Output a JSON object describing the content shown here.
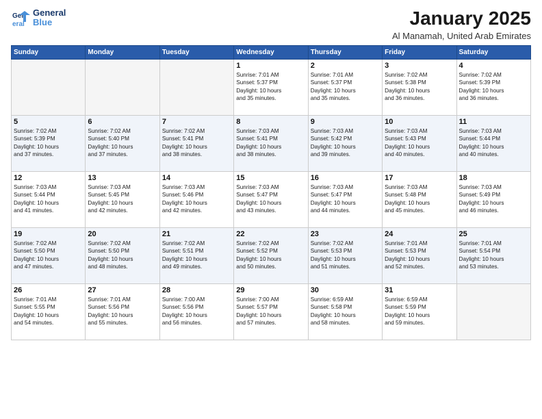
{
  "logo": {
    "line1": "General",
    "line2": "Blue"
  },
  "title": "January 2025",
  "subtitle": "Al Manamah, United Arab Emirates",
  "days_header": [
    "Sunday",
    "Monday",
    "Tuesday",
    "Wednesday",
    "Thursday",
    "Friday",
    "Saturday"
  ],
  "weeks": [
    {
      "shade": false,
      "days": [
        {
          "num": "",
          "info": ""
        },
        {
          "num": "",
          "info": ""
        },
        {
          "num": "",
          "info": ""
        },
        {
          "num": "1",
          "info": "Sunrise: 7:01 AM\nSunset: 5:37 PM\nDaylight: 10 hours\nand 35 minutes."
        },
        {
          "num": "2",
          "info": "Sunrise: 7:01 AM\nSunset: 5:37 PM\nDaylight: 10 hours\nand 35 minutes."
        },
        {
          "num": "3",
          "info": "Sunrise: 7:02 AM\nSunset: 5:38 PM\nDaylight: 10 hours\nand 36 minutes."
        },
        {
          "num": "4",
          "info": "Sunrise: 7:02 AM\nSunset: 5:39 PM\nDaylight: 10 hours\nand 36 minutes."
        }
      ]
    },
    {
      "shade": true,
      "days": [
        {
          "num": "5",
          "info": "Sunrise: 7:02 AM\nSunset: 5:39 PM\nDaylight: 10 hours\nand 37 minutes."
        },
        {
          "num": "6",
          "info": "Sunrise: 7:02 AM\nSunset: 5:40 PM\nDaylight: 10 hours\nand 37 minutes."
        },
        {
          "num": "7",
          "info": "Sunrise: 7:02 AM\nSunset: 5:41 PM\nDaylight: 10 hours\nand 38 minutes."
        },
        {
          "num": "8",
          "info": "Sunrise: 7:03 AM\nSunset: 5:41 PM\nDaylight: 10 hours\nand 38 minutes."
        },
        {
          "num": "9",
          "info": "Sunrise: 7:03 AM\nSunset: 5:42 PM\nDaylight: 10 hours\nand 39 minutes."
        },
        {
          "num": "10",
          "info": "Sunrise: 7:03 AM\nSunset: 5:43 PM\nDaylight: 10 hours\nand 40 minutes."
        },
        {
          "num": "11",
          "info": "Sunrise: 7:03 AM\nSunset: 5:44 PM\nDaylight: 10 hours\nand 40 minutes."
        }
      ]
    },
    {
      "shade": false,
      "days": [
        {
          "num": "12",
          "info": "Sunrise: 7:03 AM\nSunset: 5:44 PM\nDaylight: 10 hours\nand 41 minutes."
        },
        {
          "num": "13",
          "info": "Sunrise: 7:03 AM\nSunset: 5:45 PM\nDaylight: 10 hours\nand 42 minutes."
        },
        {
          "num": "14",
          "info": "Sunrise: 7:03 AM\nSunset: 5:46 PM\nDaylight: 10 hours\nand 42 minutes."
        },
        {
          "num": "15",
          "info": "Sunrise: 7:03 AM\nSunset: 5:47 PM\nDaylight: 10 hours\nand 43 minutes."
        },
        {
          "num": "16",
          "info": "Sunrise: 7:03 AM\nSunset: 5:47 PM\nDaylight: 10 hours\nand 44 minutes."
        },
        {
          "num": "17",
          "info": "Sunrise: 7:03 AM\nSunset: 5:48 PM\nDaylight: 10 hours\nand 45 minutes."
        },
        {
          "num": "18",
          "info": "Sunrise: 7:03 AM\nSunset: 5:49 PM\nDaylight: 10 hours\nand 46 minutes."
        }
      ]
    },
    {
      "shade": true,
      "days": [
        {
          "num": "19",
          "info": "Sunrise: 7:02 AM\nSunset: 5:50 PM\nDaylight: 10 hours\nand 47 minutes."
        },
        {
          "num": "20",
          "info": "Sunrise: 7:02 AM\nSunset: 5:50 PM\nDaylight: 10 hours\nand 48 minutes."
        },
        {
          "num": "21",
          "info": "Sunrise: 7:02 AM\nSunset: 5:51 PM\nDaylight: 10 hours\nand 49 minutes."
        },
        {
          "num": "22",
          "info": "Sunrise: 7:02 AM\nSunset: 5:52 PM\nDaylight: 10 hours\nand 50 minutes."
        },
        {
          "num": "23",
          "info": "Sunrise: 7:02 AM\nSunset: 5:53 PM\nDaylight: 10 hours\nand 51 minutes."
        },
        {
          "num": "24",
          "info": "Sunrise: 7:01 AM\nSunset: 5:53 PM\nDaylight: 10 hours\nand 52 minutes."
        },
        {
          "num": "25",
          "info": "Sunrise: 7:01 AM\nSunset: 5:54 PM\nDaylight: 10 hours\nand 53 minutes."
        }
      ]
    },
    {
      "shade": false,
      "days": [
        {
          "num": "26",
          "info": "Sunrise: 7:01 AM\nSunset: 5:55 PM\nDaylight: 10 hours\nand 54 minutes."
        },
        {
          "num": "27",
          "info": "Sunrise: 7:01 AM\nSunset: 5:56 PM\nDaylight: 10 hours\nand 55 minutes."
        },
        {
          "num": "28",
          "info": "Sunrise: 7:00 AM\nSunset: 5:56 PM\nDaylight: 10 hours\nand 56 minutes."
        },
        {
          "num": "29",
          "info": "Sunrise: 7:00 AM\nSunset: 5:57 PM\nDaylight: 10 hours\nand 57 minutes."
        },
        {
          "num": "30",
          "info": "Sunrise: 6:59 AM\nSunset: 5:58 PM\nDaylight: 10 hours\nand 58 minutes."
        },
        {
          "num": "31",
          "info": "Sunrise: 6:59 AM\nSunset: 5:59 PM\nDaylight: 10 hours\nand 59 minutes."
        },
        {
          "num": "",
          "info": ""
        }
      ]
    }
  ]
}
